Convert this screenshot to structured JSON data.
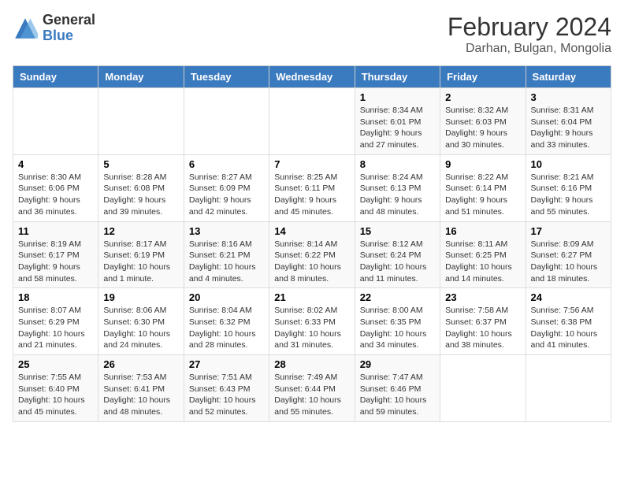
{
  "logo": {
    "general": "General",
    "blue": "Blue"
  },
  "title": "February 2024",
  "subtitle": "Darhan, Bulgan, Mongolia",
  "days_of_week": [
    "Sunday",
    "Monday",
    "Tuesday",
    "Wednesday",
    "Thursday",
    "Friday",
    "Saturday"
  ],
  "weeks": [
    [
      {
        "day": "",
        "info": ""
      },
      {
        "day": "",
        "info": ""
      },
      {
        "day": "",
        "info": ""
      },
      {
        "day": "",
        "info": ""
      },
      {
        "day": "1",
        "info": "Sunrise: 8:34 AM\nSunset: 6:01 PM\nDaylight: 9 hours and 27 minutes."
      },
      {
        "day": "2",
        "info": "Sunrise: 8:32 AM\nSunset: 6:03 PM\nDaylight: 9 hours and 30 minutes."
      },
      {
        "day": "3",
        "info": "Sunrise: 8:31 AM\nSunset: 6:04 PM\nDaylight: 9 hours and 33 minutes."
      }
    ],
    [
      {
        "day": "4",
        "info": "Sunrise: 8:30 AM\nSunset: 6:06 PM\nDaylight: 9 hours and 36 minutes."
      },
      {
        "day": "5",
        "info": "Sunrise: 8:28 AM\nSunset: 6:08 PM\nDaylight: 9 hours and 39 minutes."
      },
      {
        "day": "6",
        "info": "Sunrise: 8:27 AM\nSunset: 6:09 PM\nDaylight: 9 hours and 42 minutes."
      },
      {
        "day": "7",
        "info": "Sunrise: 8:25 AM\nSunset: 6:11 PM\nDaylight: 9 hours and 45 minutes."
      },
      {
        "day": "8",
        "info": "Sunrise: 8:24 AM\nSunset: 6:13 PM\nDaylight: 9 hours and 48 minutes."
      },
      {
        "day": "9",
        "info": "Sunrise: 8:22 AM\nSunset: 6:14 PM\nDaylight: 9 hours and 51 minutes."
      },
      {
        "day": "10",
        "info": "Sunrise: 8:21 AM\nSunset: 6:16 PM\nDaylight: 9 hours and 55 minutes."
      }
    ],
    [
      {
        "day": "11",
        "info": "Sunrise: 8:19 AM\nSunset: 6:17 PM\nDaylight: 9 hours and 58 minutes."
      },
      {
        "day": "12",
        "info": "Sunrise: 8:17 AM\nSunset: 6:19 PM\nDaylight: 10 hours and 1 minute."
      },
      {
        "day": "13",
        "info": "Sunrise: 8:16 AM\nSunset: 6:21 PM\nDaylight: 10 hours and 4 minutes."
      },
      {
        "day": "14",
        "info": "Sunrise: 8:14 AM\nSunset: 6:22 PM\nDaylight: 10 hours and 8 minutes."
      },
      {
        "day": "15",
        "info": "Sunrise: 8:12 AM\nSunset: 6:24 PM\nDaylight: 10 hours and 11 minutes."
      },
      {
        "day": "16",
        "info": "Sunrise: 8:11 AM\nSunset: 6:25 PM\nDaylight: 10 hours and 14 minutes."
      },
      {
        "day": "17",
        "info": "Sunrise: 8:09 AM\nSunset: 6:27 PM\nDaylight: 10 hours and 18 minutes."
      }
    ],
    [
      {
        "day": "18",
        "info": "Sunrise: 8:07 AM\nSunset: 6:29 PM\nDaylight: 10 hours and 21 minutes."
      },
      {
        "day": "19",
        "info": "Sunrise: 8:06 AM\nSunset: 6:30 PM\nDaylight: 10 hours and 24 minutes."
      },
      {
        "day": "20",
        "info": "Sunrise: 8:04 AM\nSunset: 6:32 PM\nDaylight: 10 hours and 28 minutes."
      },
      {
        "day": "21",
        "info": "Sunrise: 8:02 AM\nSunset: 6:33 PM\nDaylight: 10 hours and 31 minutes."
      },
      {
        "day": "22",
        "info": "Sunrise: 8:00 AM\nSunset: 6:35 PM\nDaylight: 10 hours and 34 minutes."
      },
      {
        "day": "23",
        "info": "Sunrise: 7:58 AM\nSunset: 6:37 PM\nDaylight: 10 hours and 38 minutes."
      },
      {
        "day": "24",
        "info": "Sunrise: 7:56 AM\nSunset: 6:38 PM\nDaylight: 10 hours and 41 minutes."
      }
    ],
    [
      {
        "day": "25",
        "info": "Sunrise: 7:55 AM\nSunset: 6:40 PM\nDaylight: 10 hours and 45 minutes."
      },
      {
        "day": "26",
        "info": "Sunrise: 7:53 AM\nSunset: 6:41 PM\nDaylight: 10 hours and 48 minutes."
      },
      {
        "day": "27",
        "info": "Sunrise: 7:51 AM\nSunset: 6:43 PM\nDaylight: 10 hours and 52 minutes."
      },
      {
        "day": "28",
        "info": "Sunrise: 7:49 AM\nSunset: 6:44 PM\nDaylight: 10 hours and 55 minutes."
      },
      {
        "day": "29",
        "info": "Sunrise: 7:47 AM\nSunset: 6:46 PM\nDaylight: 10 hours and 59 minutes."
      },
      {
        "day": "",
        "info": ""
      },
      {
        "day": "",
        "info": ""
      }
    ]
  ]
}
